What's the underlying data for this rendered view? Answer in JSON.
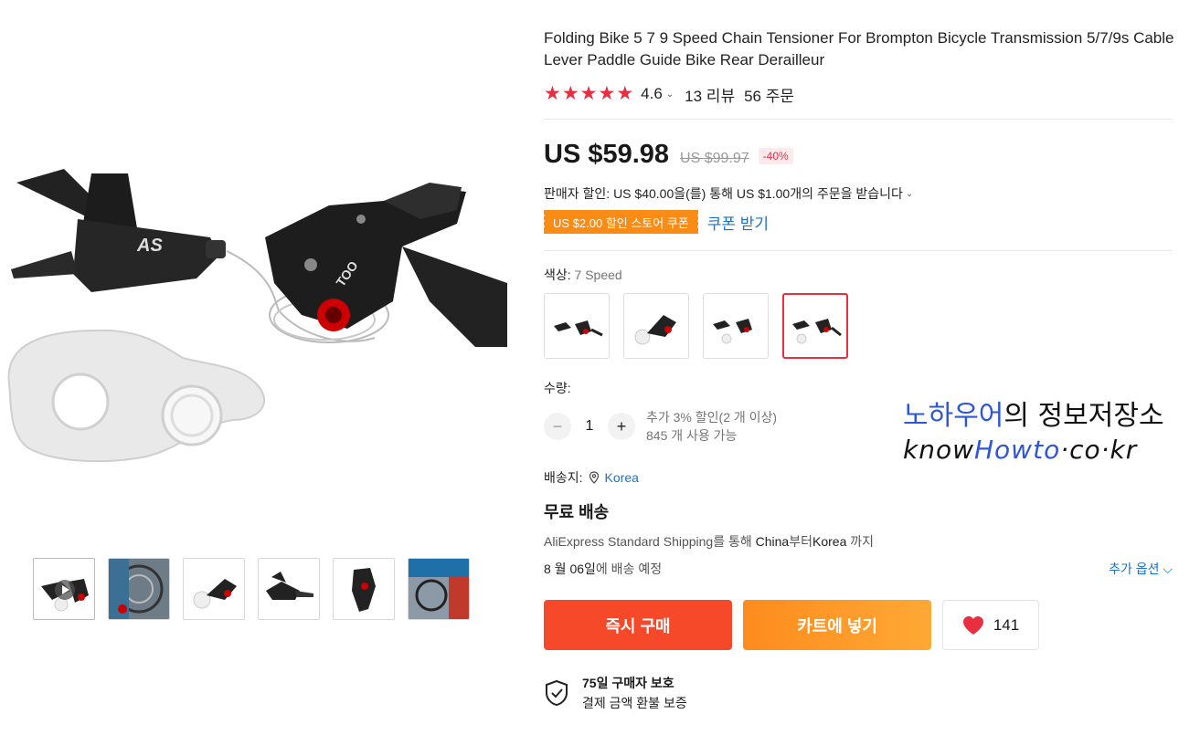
{
  "product": {
    "title": "Folding Bike 5 7 9 Speed Chain Tensioner For Brompton Bicycle Transmission 5/7/9s Cable Lever Paddle Guide Bike Rear Derailleur",
    "rating": "4.6",
    "rating_stars": 5,
    "reviews": "13 리뷰",
    "orders": "56 주문"
  },
  "price": {
    "current": "US $59.98",
    "original": "US $99.97",
    "discount": "-40%"
  },
  "promo": {
    "seller_discount": "판매자 할인: US $40.00을(를) 통해 US $1.00개의 주문을 받습니다",
    "coupon": "US $2.00 할인 스토어 쿠폰",
    "coupon_action": "쿠폰 받기"
  },
  "color": {
    "label": "색상:",
    "value": "7 Speed",
    "selected_index": 3
  },
  "quantity": {
    "label": "수량:",
    "value": "1",
    "minus": "−",
    "plus": "+",
    "note1": "추가 3% 할인(2 개 이상)",
    "note2": "845 개 사용 가능"
  },
  "shipping": {
    "label": "배송지:",
    "country": "Korea",
    "free": "무료 배송",
    "method_prefix": "AliExpress Standard Shipping를 통해 ",
    "from": "China",
    "method_mid": "부터",
    "to": "Korea",
    "method_suffix": " 까지",
    "date_prefix": "8 월 06일",
    "date_suffix": "에 배송 예정",
    "more_options": "추가 옵션"
  },
  "actions": {
    "buy_now": "즉시 구매",
    "add_to_cart": "카트에 넣기",
    "wishlist_count": "141"
  },
  "protection": {
    "title": "75일 구매자 보호",
    "subtitle": "결제 금액 환불 보증"
  },
  "watermark": {
    "line1_blue": "노하우어",
    "line1_black": "의 정보저장소",
    "line2_pre": "know",
    "line2_blue": "Howto",
    "line2_post": "·co·kr"
  },
  "colors": {
    "accent_red": "#e82e3f",
    "link_blue": "#1a73c9",
    "buy_orange_red": "#f6492a",
    "cart_orange": "#fd9a2a"
  }
}
